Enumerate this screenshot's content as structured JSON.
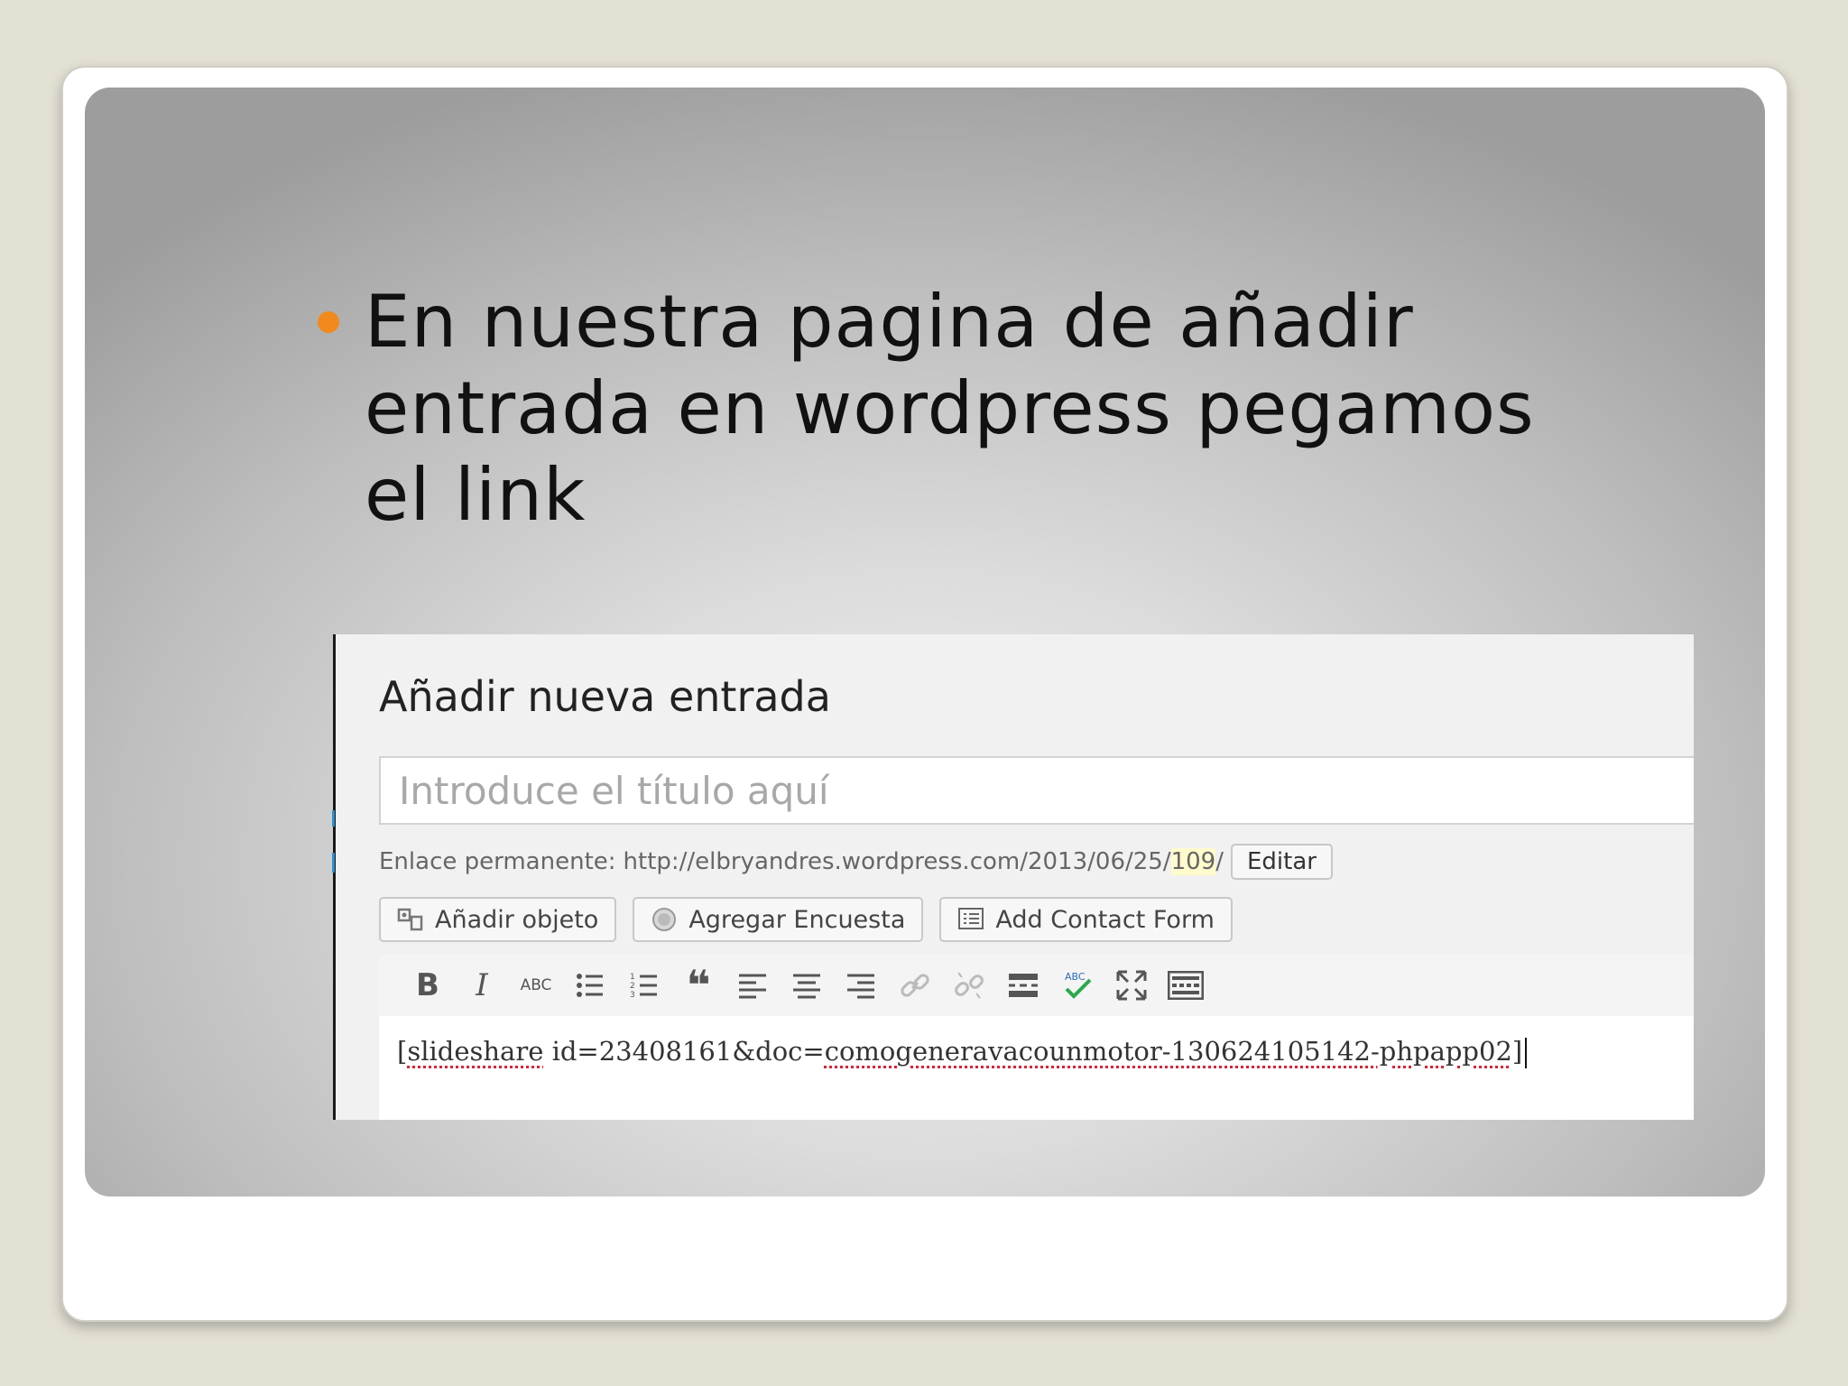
{
  "slide": {
    "bullet_text": "En nuestra pagina de añadir entrada en wordpress pegamos el link",
    "bullet_color": "#f08a1c"
  },
  "wp": {
    "page_title": "Añadir nueva entrada",
    "title_placeholder": "Introduce el título aquí",
    "permalink_label": "Enlace permanente:",
    "permalink_url_prefix": "http://elbryandres.wordpress.com/2013/06/25/",
    "permalink_slug": "109",
    "permalink_url_suffix": "/",
    "edit_button": "Editar",
    "buttons": {
      "add_object": "Añadir objeto",
      "add_poll": "Agregar Encuesta",
      "add_contact_form": "Add Contact Form"
    },
    "toolbar": {
      "bold": "B",
      "italic": "I",
      "strikethrough": "ABC",
      "blockquote": "❝"
    },
    "editor": {
      "text_prefix": "[",
      "word_slideshare": "slideshare",
      "text_middle": " id=23408161&doc=",
      "word_slug": "comogeneravacounmotor-130624105142-phpapp02",
      "text_suffix": "]"
    }
  }
}
